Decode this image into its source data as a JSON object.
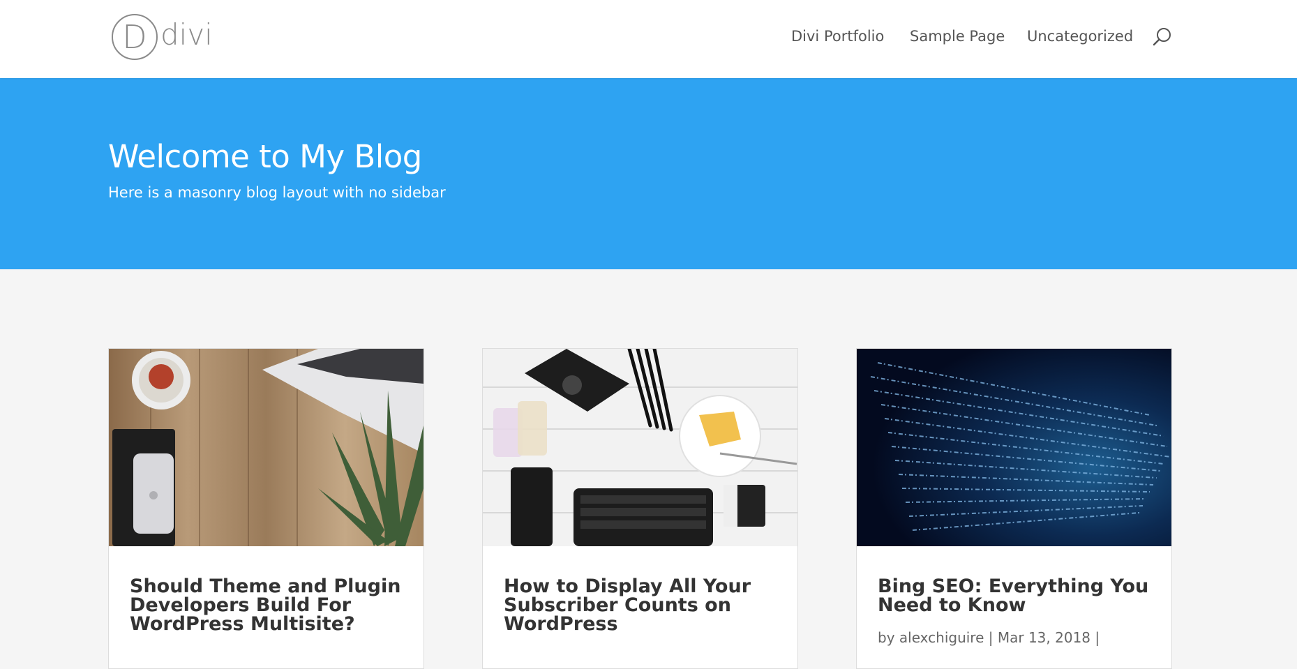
{
  "header": {
    "logo_letter": "D",
    "logo_text": "divi",
    "nav": [
      {
        "label": "Divi Portfolio"
      },
      {
        "label": "Sample Page"
      },
      {
        "label": "Uncategorized"
      }
    ]
  },
  "hero": {
    "title": "Welcome to My Blog",
    "subtitle": "Here is a masonry blog layout with no sidebar",
    "background": "#2ea3f2"
  },
  "posts": [
    {
      "title": "Should Theme and Plugin Developers Build For WordPress Multisite?",
      "image_icon": "desk-laptop-pineapple-image"
    },
    {
      "title": "How to Display All Your Subscriber Counts on WordPress",
      "image_icon": "desk-keyboard-flatlay-image"
    },
    {
      "title": "Bing SEO: Everything You Need to Know",
      "image_icon": "code-tunnel-image",
      "meta": {
        "by": "by",
        "author": "alexchiguire",
        "sep": "|",
        "date": "Mar 13, 2018",
        "sep2": "|"
      }
    }
  ],
  "colors": {
    "accent": "#2ea3f2",
    "page_bg": "#f5f5f5"
  }
}
